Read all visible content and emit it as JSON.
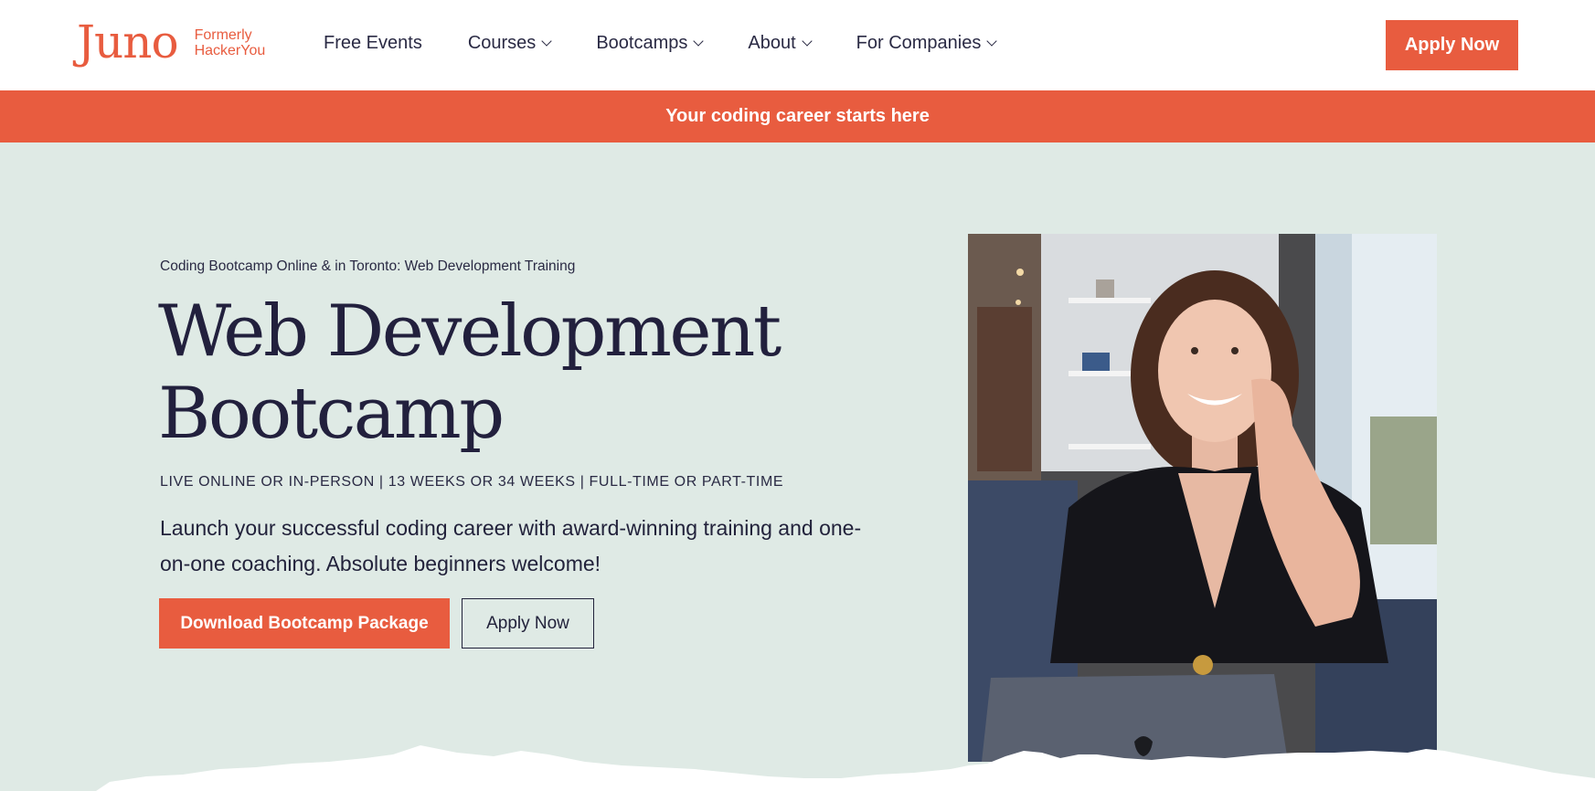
{
  "header": {
    "logo_word": "Juno",
    "logo_sub_line1": "Formerly",
    "logo_sub_line2": "HackerYou",
    "nav": [
      {
        "label": "Free Events",
        "has_dropdown": false
      },
      {
        "label": "Courses",
        "has_dropdown": true
      },
      {
        "label": "Bootcamps",
        "has_dropdown": true
      },
      {
        "label": "About",
        "has_dropdown": true
      },
      {
        "label": "For Companies",
        "has_dropdown": true
      }
    ],
    "apply_label": "Apply Now"
  },
  "banner": {
    "text": "Your coding career starts here"
  },
  "hero": {
    "eyebrow": "Coding Bootcamp Online & in Toronto: Web Development Training",
    "title_line1": "Web Development",
    "title_line2": "Bootcamp",
    "meta": "LIVE ONLINE OR IN-PERSON | 13 WEEKS OR 34 WEEKS | FULL-TIME OR PART-TIME",
    "description": "Launch your successful coding career with award-winning training and one-on-one coaching. Absolute beginners welcome!",
    "primary_button": "Download Bootcamp Package",
    "secondary_button": "Apply Now"
  },
  "colors": {
    "accent": "#e85c3f",
    "hero_background": "#dfeae5",
    "text_dark": "#22203d",
    "header_background": "#ffffff"
  },
  "icons": [
    "chevron-down-icon",
    "apple-logo-icon"
  ]
}
